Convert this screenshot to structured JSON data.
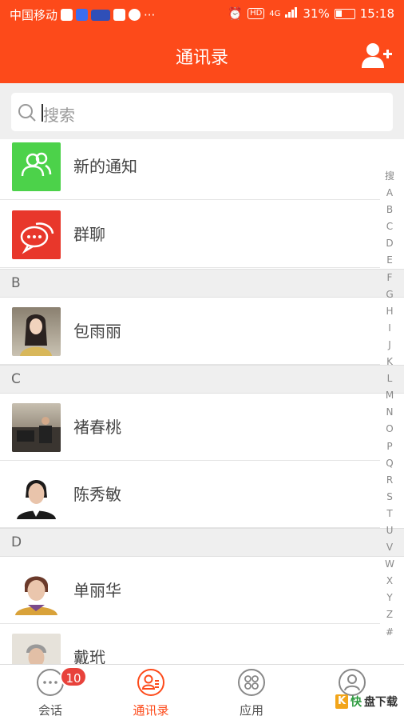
{
  "status_bar": {
    "carrier": "中国移动",
    "dots": "···",
    "hd": "HD",
    "network": "4G",
    "battery": "31%",
    "time": "15:18"
  },
  "header": {
    "title": "通讯录"
  },
  "search": {
    "placeholder": "搜索"
  },
  "fixed_items": [
    {
      "label": "新的通知",
      "color": "#4cd24a",
      "icon": "contacts-icon"
    },
    {
      "label": "群聊",
      "color": "#e8372b",
      "icon": "chat-bubble-icon"
    }
  ],
  "sections": [
    {
      "letter": "B",
      "contacts": [
        "包雨丽"
      ]
    },
    {
      "letter": "C",
      "contacts": [
        "褚春桃",
        "陈秀敏"
      ]
    },
    {
      "letter": "D",
      "contacts": [
        "单丽华",
        "戴玳"
      ]
    }
  ],
  "index_bar": [
    "搜",
    "A",
    "B",
    "C",
    "D",
    "E",
    "F",
    "G",
    "H",
    "I",
    "J",
    "K",
    "L",
    "M",
    "N",
    "O",
    "P",
    "Q",
    "R",
    "S",
    "T",
    "U",
    "V",
    "W",
    "X",
    "Y",
    "Z",
    "#"
  ],
  "tabs": [
    {
      "label": "会话",
      "badge": "10",
      "icon": "chat-dots-icon"
    },
    {
      "label": "通讯录",
      "icon": "contact-book-icon",
      "active": true
    },
    {
      "label": "应用",
      "icon": "apps-grid-icon"
    },
    {
      "label": "",
      "icon": "profile-icon"
    }
  ],
  "brand": {
    "k": "K",
    "t1": "快",
    "t2": "盘下载"
  },
  "accent": "#fd4a1a"
}
